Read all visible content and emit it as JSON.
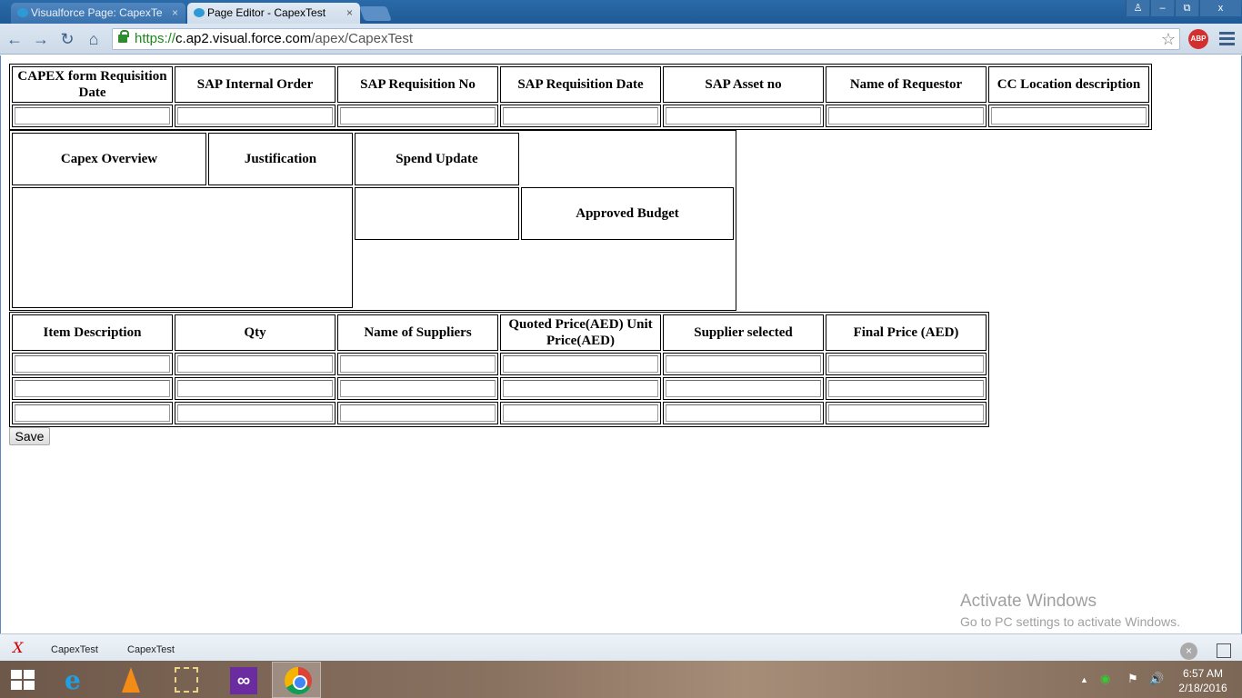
{
  "browser": {
    "tabs": [
      {
        "label": "Visualforce Page: CapexTe",
        "active": false
      },
      {
        "label": "Page Editor - CapexTest",
        "active": true
      }
    ],
    "url": {
      "scheme": "https://",
      "host": "c.ap2.visual.force.com",
      "path": "/apex/CapexTest"
    },
    "window_buttons": {
      "user": "♙",
      "minimize": "–",
      "restore": "⧉",
      "close": "x"
    },
    "nav": {
      "back": "←",
      "forward": "→",
      "reload": "↻",
      "home": "⌂"
    },
    "bookmark_star": "☆",
    "abp_label": "ABP"
  },
  "form": {
    "header_table": {
      "columns": [
        "CAPEX form Requisition Date",
        "SAP Internal Order",
        "SAP Requisition No",
        "SAP Requisition Date",
        "SAP Asset no",
        "Name of Requestor",
        "CC Location description"
      ]
    },
    "overview_table": {
      "capex_overview": "Capex Overview",
      "justification": "Justification",
      "spend_update": "Spend Update",
      "approved_budget": "Approved Budget"
    },
    "items_table": {
      "columns": [
        "Item Description",
        "Qty",
        "Name of Suppliers",
        "Quoted Price(AED) Unit Price(AED)",
        "Supplier selected",
        "Final Price (AED)"
      ],
      "row_count": 3
    },
    "save_label": "Save"
  },
  "watermark": {
    "title": "Activate Windows",
    "subtitle": "Go to PC settings to activate Windows."
  },
  "bottom_bar": {
    "items": [
      "CapexTest",
      "CapexTest"
    ]
  },
  "taskbar": {
    "apps": [
      "internet-explorer",
      "vlc",
      "snipping-tool",
      "visual-studio",
      "chrome"
    ],
    "clock_time": "6:57 AM",
    "clock_date": "2/18/2016"
  }
}
